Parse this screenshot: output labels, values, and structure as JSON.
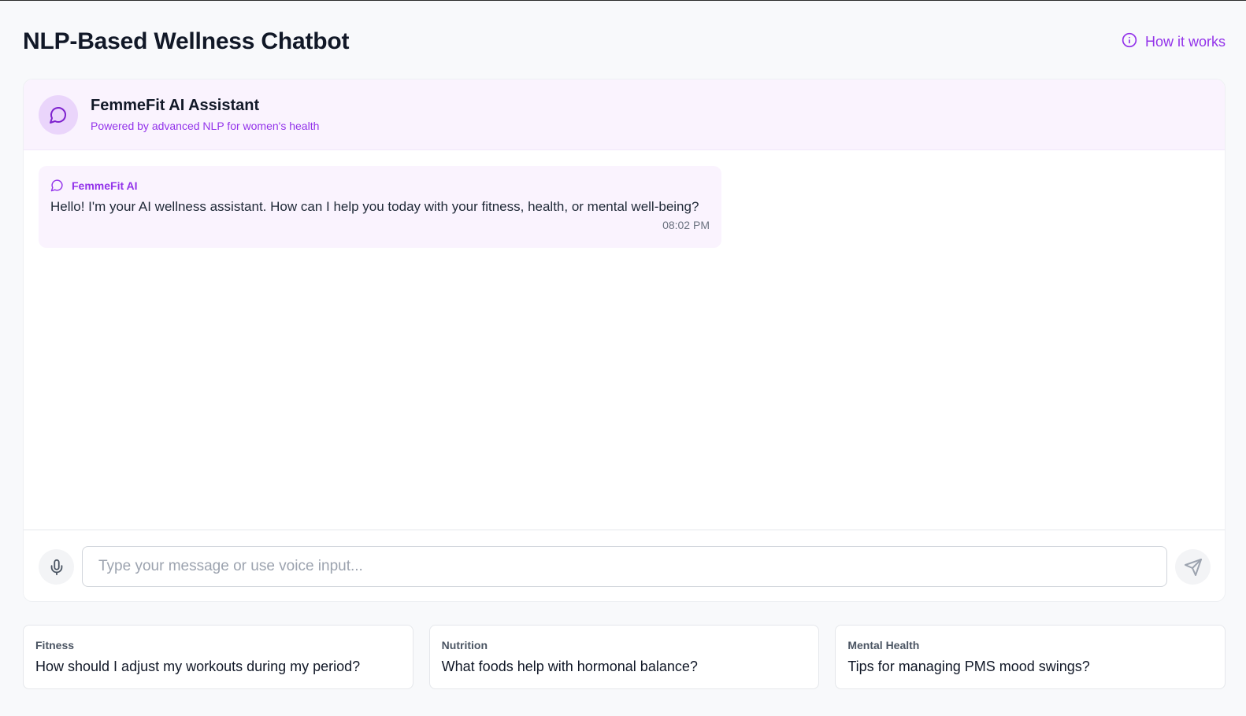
{
  "page": {
    "title": "NLP-Based Wellness Chatbot",
    "how_it_works_label": "How it works"
  },
  "assistant": {
    "name": "FemmeFit AI Assistant",
    "subtitle": "Powered by advanced NLP for women's health"
  },
  "messages": [
    {
      "sender": "FemmeFit AI",
      "text": "Hello! I'm your AI wellness assistant. How can I help you today with your fitness, health, or mental well-being?",
      "time": "08:02 PM"
    }
  ],
  "input": {
    "placeholder": "Type your message or use voice input...",
    "value": ""
  },
  "suggestions": [
    {
      "category": "Fitness",
      "text": "How should I adjust my workouts during my period?"
    },
    {
      "category": "Nutrition",
      "text": "What foods help with hormonal balance?"
    },
    {
      "category": "Mental Health",
      "text": "Tips for managing PMS mood swings?"
    }
  ],
  "icons": {
    "info": "info-icon",
    "chat": "message-circle-icon",
    "mic": "mic-icon",
    "send": "send-icon"
  },
  "colors": {
    "accent": "#9333ea",
    "header_bg": "#faf3fe",
    "avatar_bg": "#ead5fb"
  }
}
